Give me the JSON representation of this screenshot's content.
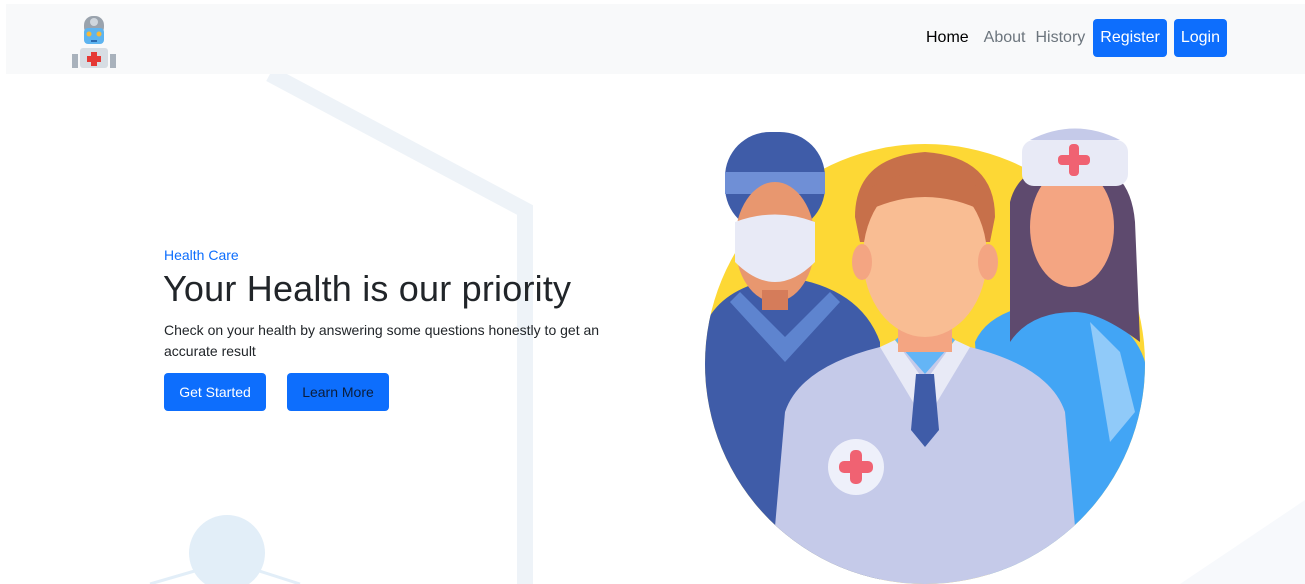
{
  "nav": {
    "logo_icon": "robot-doctor-icon",
    "links": [
      "Home",
      "About",
      "History"
    ],
    "register_label": "Register",
    "login_label": "Login"
  },
  "hero": {
    "eyebrow": "Health Care",
    "title": "Your Health is our priority",
    "description": "Check on your health by answering some questions honestly to get an accurate result",
    "get_started_label": "Get Started",
    "learn_more_label": "Learn More",
    "illustration_icon": "medical-team-illustration"
  },
  "colors": {
    "primary": "#0d6efd",
    "navbar_bg": "#f8f9fa",
    "illustration_bg": "#fdd835"
  }
}
